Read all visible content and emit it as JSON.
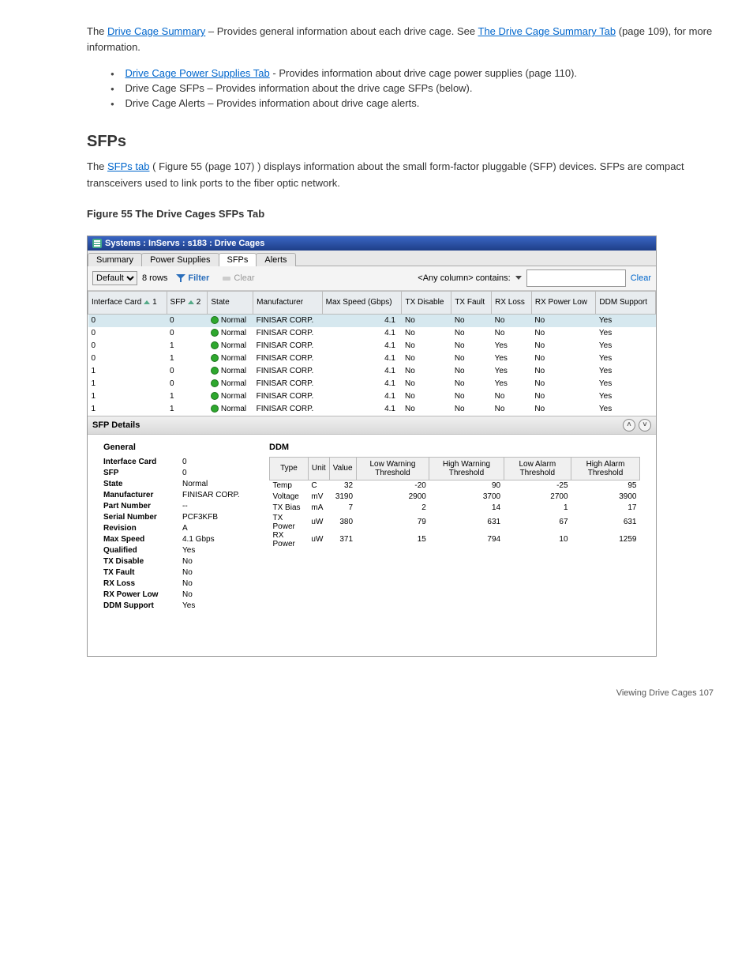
{
  "doc": {
    "intro_prefix": "The ",
    "intro_link1": "Drive Cage Summary",
    "intro_mid": " - Provides general information about each drive cage. See ",
    "intro_link2": "The Drive Cage Summary Tab",
    "intro_after": " (page 109), for more information.",
    "bullet2_link": "Drive Cage Power Supplies Tab",
    "bullet2_text": " - Provides information about drive cage power supplies (page 110).",
    "bullet3": "Drive Cage SFPs – Provides information about the drive cage SFPs (below).",
    "bullet4": "Drive Cage Alerts – Provides information about drive cage alerts.",
    "sfps_heading": "SFPs",
    "sfps_para_prefix": "",
    "sfps_para_link": "SFPs tab",
    "sfps_para_label": "Figure 55 (page 107)",
    "sfps_para_text": ") displays information about the small form-factor pluggable (SFP) devices. SFPs are compact transceivers used to link ports to the fiber optic network.",
    "figure_caption": "Figure 55 The Drive Cages SFPs Tab"
  },
  "app": {
    "title": "Systems : InServs : s183 : Drive Cages",
    "tabs": [
      "Summary",
      "Power Supplies",
      "SFPs",
      "Alerts"
    ],
    "active_tab": 2,
    "toolbar": {
      "view_select": "Default",
      "row_count": "8 rows",
      "filter_label": "Filter",
      "clear_label": "Clear",
      "contains_label": "<Any column> contains:",
      "clear_link": "Clear"
    },
    "columns": [
      {
        "label": "Interface Card",
        "sort": 1
      },
      {
        "label": "SFP",
        "sort": 2
      },
      {
        "label": "State"
      },
      {
        "label": "Manufacturer"
      },
      {
        "label": "Max Speed (Gbps)"
      },
      {
        "label": "TX Disable"
      },
      {
        "label": "TX Fault"
      },
      {
        "label": "RX Loss"
      },
      {
        "label": "RX Power Low"
      },
      {
        "label": "DDM Support"
      }
    ],
    "rows": [
      {
        "ic": "0",
        "sfp": "0",
        "state": "Normal",
        "mfg": "FINISAR CORP.",
        "max": "4.1",
        "txd": "No",
        "txf": "No",
        "rxl": "No",
        "rpl": "No",
        "ddm": "Yes",
        "sel": true
      },
      {
        "ic": "0",
        "sfp": "0",
        "state": "Normal",
        "mfg": "FINISAR CORP.",
        "max": "4.1",
        "txd": "No",
        "txf": "No",
        "rxl": "No",
        "rpl": "No",
        "ddm": "Yes"
      },
      {
        "ic": "0",
        "sfp": "1",
        "state": "Normal",
        "mfg": "FINISAR CORP.",
        "max": "4.1",
        "txd": "No",
        "txf": "No",
        "rxl": "Yes",
        "rpl": "No",
        "ddm": "Yes"
      },
      {
        "ic": "0",
        "sfp": "1",
        "state": "Normal",
        "mfg": "FINISAR CORP.",
        "max": "4.1",
        "txd": "No",
        "txf": "No",
        "rxl": "Yes",
        "rpl": "No",
        "ddm": "Yes"
      },
      {
        "ic": "1",
        "sfp": "0",
        "state": "Normal",
        "mfg": "FINISAR CORP.",
        "max": "4.1",
        "txd": "No",
        "txf": "No",
        "rxl": "Yes",
        "rpl": "No",
        "ddm": "Yes"
      },
      {
        "ic": "1",
        "sfp": "0",
        "state": "Normal",
        "mfg": "FINISAR CORP.",
        "max": "4.1",
        "txd": "No",
        "txf": "No",
        "rxl": "Yes",
        "rpl": "No",
        "ddm": "Yes"
      },
      {
        "ic": "1",
        "sfp": "1",
        "state": "Normal",
        "mfg": "FINISAR CORP.",
        "max": "4.1",
        "txd": "No",
        "txf": "No",
        "rxl": "No",
        "rpl": "No",
        "ddm": "Yes"
      },
      {
        "ic": "1",
        "sfp": "1",
        "state": "Normal",
        "mfg": "FINISAR CORP.",
        "max": "4.1",
        "txd": "No",
        "txf": "No",
        "rxl": "No",
        "rpl": "No",
        "ddm": "Yes"
      }
    ],
    "details_title": "SFP Details",
    "general_heading": "General",
    "general": [
      {
        "k": "Interface Card",
        "v": "0"
      },
      {
        "k": "SFP",
        "v": "0"
      },
      {
        "k": "State",
        "v": "Normal"
      },
      {
        "k": "Manufacturer",
        "v": "FINISAR CORP."
      },
      {
        "k": "Part Number",
        "v": "--"
      },
      {
        "k": "Serial Number",
        "v": "PCF3KFB"
      },
      {
        "k": "Revision",
        "v": "A"
      },
      {
        "k": "Max Speed",
        "v": "4.1 Gbps"
      },
      {
        "k": "Qualified",
        "v": "Yes"
      },
      {
        "k": "TX Disable",
        "v": "No"
      },
      {
        "k": "TX Fault",
        "v": "No"
      },
      {
        "k": "RX Loss",
        "v": "No"
      },
      {
        "k": "RX Power Low",
        "v": "No"
      },
      {
        "k": "DDM Support",
        "v": "Yes"
      }
    ],
    "ddm_heading": "DDM",
    "ddm_cols": [
      "Type",
      "Unit",
      "Value",
      "Low Warning Threshold",
      "High Warning Threshold",
      "Low Alarm Threshold",
      "High Alarm Threshold"
    ],
    "ddm_rows": [
      {
        "t": "Temp",
        "u": "C",
        "v": "32",
        "lw": "-20",
        "hw": "90",
        "la": "-25",
        "ha": "95"
      },
      {
        "t": "Voltage",
        "u": "mV",
        "v": "3190",
        "lw": "2900",
        "hw": "3700",
        "la": "2700",
        "ha": "3900"
      },
      {
        "t": "TX Bias",
        "u": "mA",
        "v": "7",
        "lw": "2",
        "hw": "14",
        "la": "1",
        "ha": "17"
      },
      {
        "t": "TX Power",
        "u": "uW",
        "v": "380",
        "lw": "79",
        "hw": "631",
        "la": "67",
        "ha": "631"
      },
      {
        "t": "RX Power",
        "u": "uW",
        "v": "371",
        "lw": "15",
        "hw": "794",
        "la": "10",
        "ha": "1259"
      }
    ]
  },
  "footer": {
    "left": "",
    "right": "Viewing Drive Cages 107"
  }
}
